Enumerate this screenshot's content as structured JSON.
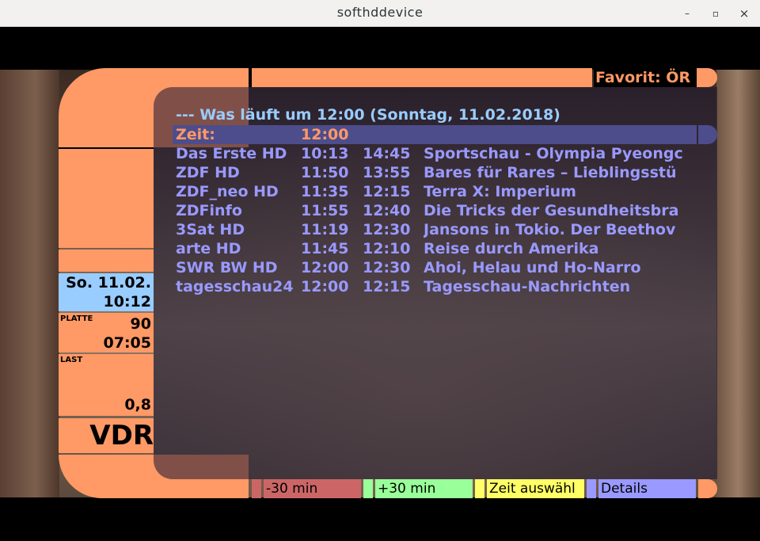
{
  "window": {
    "title": "softhddevice",
    "minimize_glyph": "–",
    "maximize_glyph": "▫",
    "close_glyph": "×"
  },
  "header": {
    "favorite": "Favorit: ÖR"
  },
  "sidebar": {
    "date": "So. 11.02.",
    "time": "10:12",
    "disk_label": "PLATTE",
    "disk_percent": "90",
    "disk_time": "07:05",
    "load_label": "LAST",
    "load_value": "0,8",
    "logo": "VDR"
  },
  "schedule": {
    "heading": "--- Was läuft um 12:00 (Sonntag, 11.02.2018)",
    "time_label": "Zeit:",
    "time_value": "12:00",
    "rows": [
      {
        "channel": "Das Erste HD",
        "start": "10:13",
        "end": "14:45",
        "title": "Sportschau - Olympia Pyeongc"
      },
      {
        "channel": "ZDF HD",
        "start": "11:50",
        "end": "13:55",
        "title": "Bares für Rares – Lieblingsstü"
      },
      {
        "channel": "ZDF_neo HD",
        "start": "11:35",
        "end": "12:15",
        "title": "Terra X: Imperium"
      },
      {
        "channel": "ZDFinfo",
        "start": "11:55",
        "end": "12:40",
        "title": "Die Tricks der Gesundheitsbra"
      },
      {
        "channel": "3Sat HD",
        "start": "11:19",
        "end": "12:30",
        "title": "Jansons in Tokio. Der Beethov"
      },
      {
        "channel": "arte HD",
        "start": "11:45",
        "end": "12:10",
        "title": "Reise durch Amerika"
      },
      {
        "channel": "SWR BW HD",
        "start": "12:00",
        "end": "12:30",
        "title": "Ahoi, Helau und Ho-Narro"
      },
      {
        "channel": "tagesschau24",
        "start": "12:00",
        "end": "12:15",
        "title": "Tagesschau-Nachrichten"
      }
    ]
  },
  "buttons": {
    "red": "-30 min",
    "green": "+30 min",
    "yellow": "Zeit auswähl",
    "blue": "Details"
  },
  "colors": {
    "lcars_orange": "#ff9966",
    "lcars_blue": "#99ccff",
    "text_violet": "#9999ff",
    "button_red": "#cc6666",
    "button_green": "#99ff99",
    "button_yellow": "#ffff66",
    "button_blue": "#9999ff"
  }
}
